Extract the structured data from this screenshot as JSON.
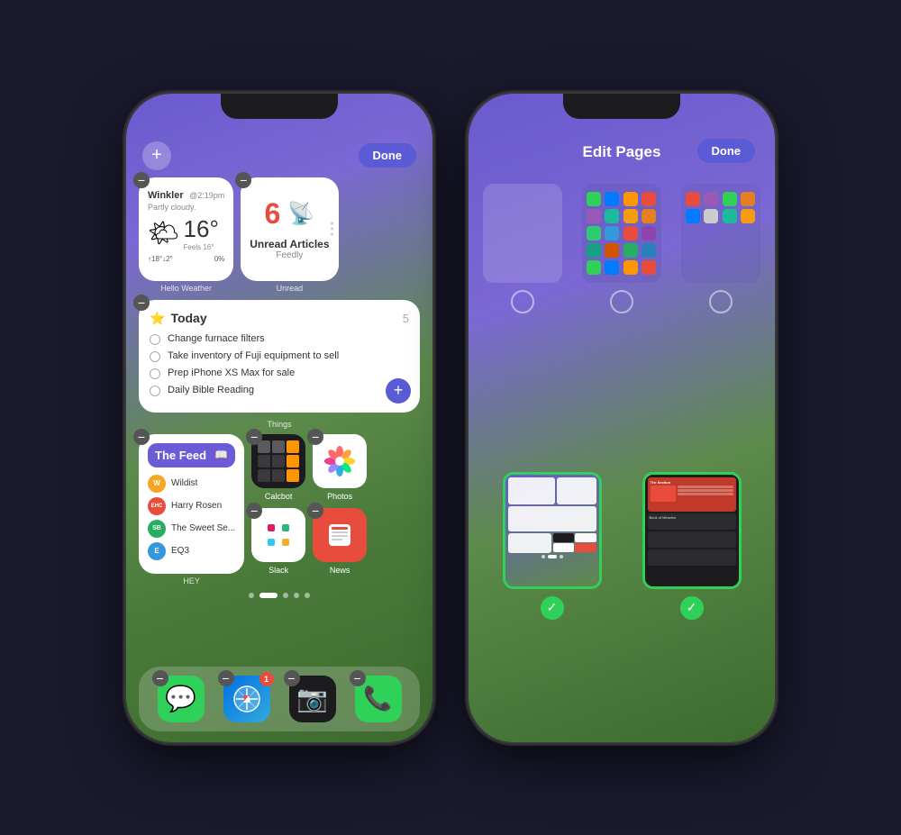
{
  "phone1": {
    "done_btn": "Done",
    "plus_btn": "+",
    "weather": {
      "location": "Winkler",
      "time": "@2:19pm",
      "desc": "Partly cloudy.",
      "temp": "16°",
      "feels": "Feels 16°",
      "high": "↑18°",
      "low": "↓2°",
      "precip": "0%",
      "label": "Hello Weather"
    },
    "feedly": {
      "count": "6",
      "label": "Unread Articles",
      "sub": "Feedly",
      "widget_label": "Unread"
    },
    "things": {
      "title": "Today",
      "count": "5",
      "items": [
        "Change furnace filters",
        "Take inventory of Fuji equipment to sell",
        "Prep iPhone XS Max for sale",
        "Daily Bible Reading"
      ],
      "label": "Things"
    },
    "feed": {
      "title": "The Feed",
      "items": [
        "Wildist",
        "Harry Rosen",
        "The Sweet Se...",
        "EQ3"
      ],
      "avatars": [
        "W",
        "EHC",
        "SB",
        "E"
      ],
      "label": "HEY"
    },
    "apps": {
      "calcbot": "Calcbot",
      "photos": "Photos",
      "slack": "Slack",
      "news": "News"
    },
    "dock": {
      "messages": "Messages",
      "safari": "Safari",
      "camera": "Camera",
      "phone": "Phone",
      "badge": "1"
    }
  },
  "phone2": {
    "done_btn": "Done",
    "title": "Edit Pages",
    "pages": [
      {
        "label": "page-1",
        "selected": false
      },
      {
        "label": "page-2",
        "selected": false
      },
      {
        "label": "page-3",
        "selected": false
      }
    ],
    "bottom_pages": [
      {
        "label": "page-4",
        "selected": true
      },
      {
        "label": "page-5",
        "selected": true
      }
    ]
  }
}
